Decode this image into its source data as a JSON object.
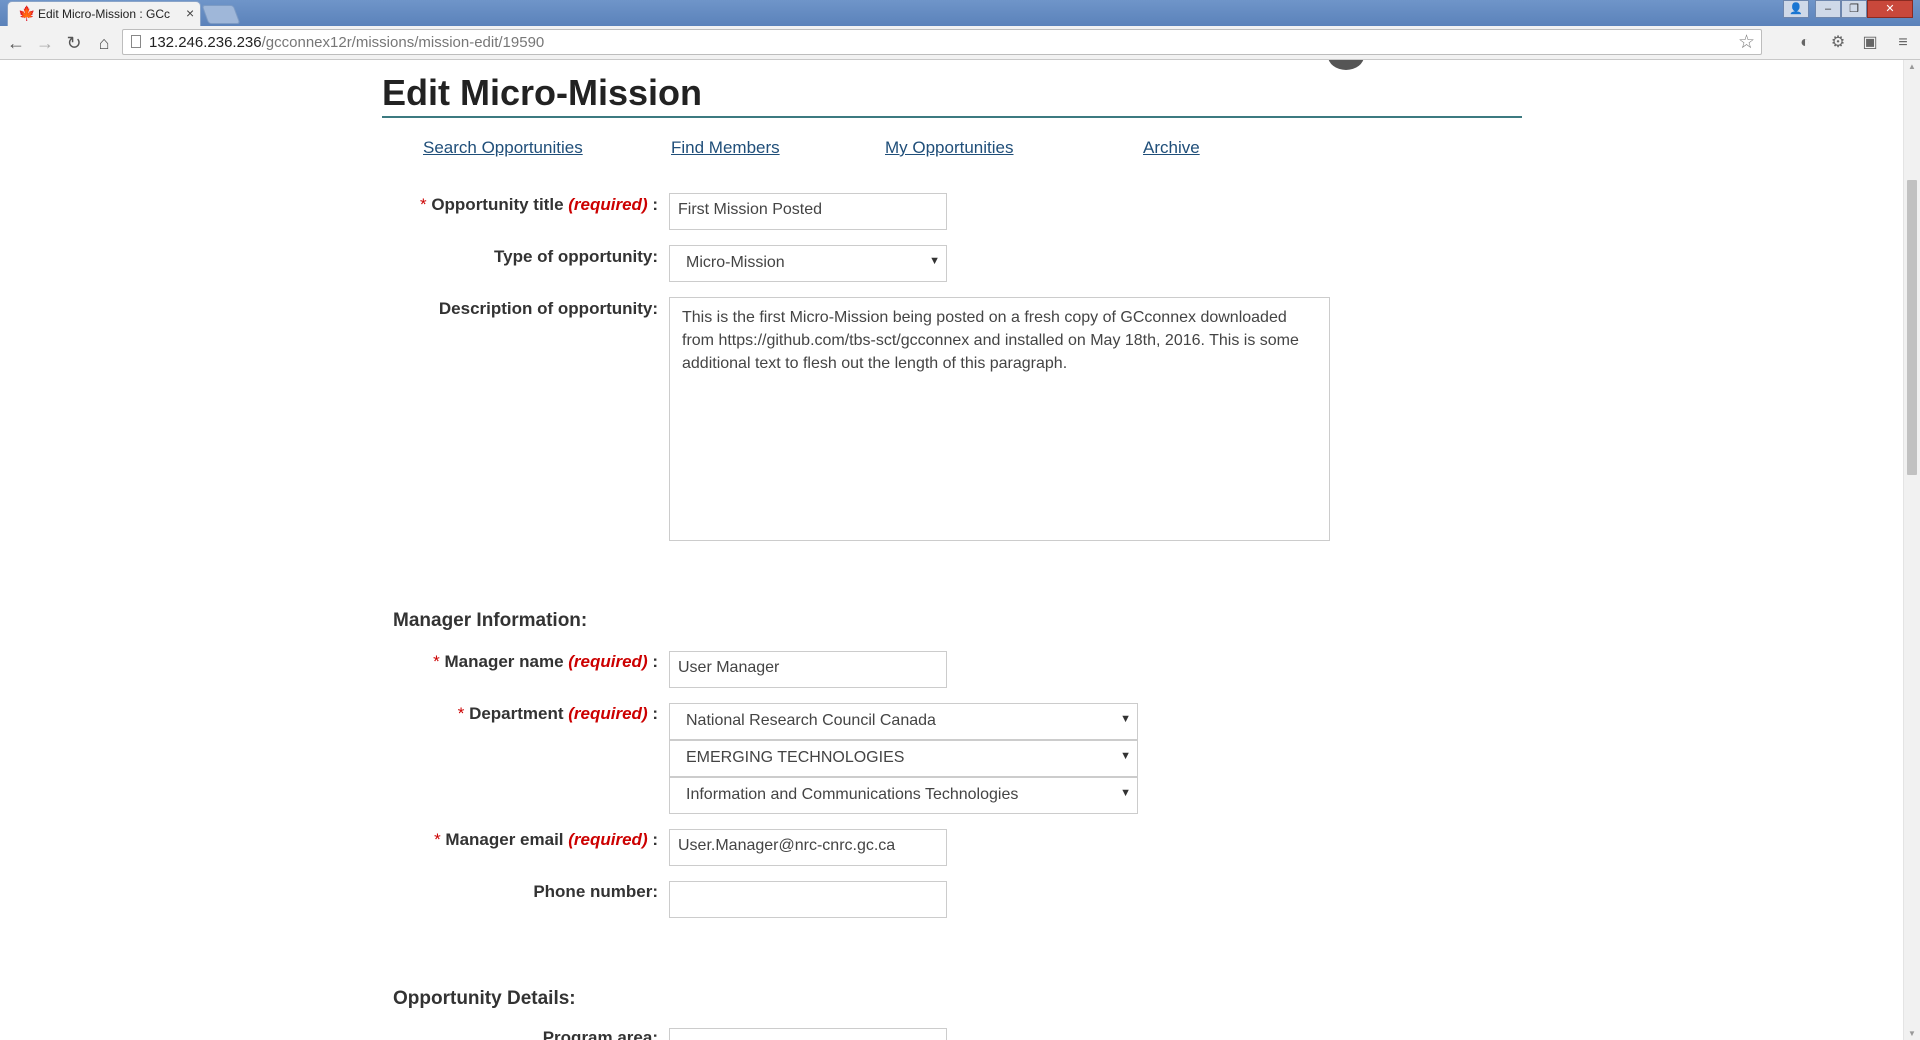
{
  "browser": {
    "tab_title": "Edit Micro-Mission : GCc",
    "url_host": "132.246.236.236",
    "url_path": "/gcconnex12r/missions/mission-edit/19590"
  },
  "page": {
    "title": "Edit Micro-Mission",
    "nav": [
      "Search Opportunities",
      "Find Members",
      "My Opportunities",
      "Archive"
    ]
  },
  "form": {
    "required_text": "(required)",
    "opportunity_title": {
      "label": "Opportunity title",
      "value": "First Mission Posted"
    },
    "type": {
      "label": "Type of opportunity:",
      "value": "Micro-Mission"
    },
    "description": {
      "label": "Description of opportunity:",
      "value": "This is the first Micro-Mission being posted on a fresh copy of GCconnex downloaded from https://github.com/tbs-sct/gcconnex and installed on May 18th, 2016. This is some additional text to flesh out the length of this paragraph."
    },
    "manager_section": "Manager Information:",
    "manager_name": {
      "label": "Manager name",
      "value": "User Manager"
    },
    "department": {
      "label": "Department",
      "values": [
        "National Research Council Canada",
        "EMERGING TECHNOLOGIES",
        "Information and Communications Technologies"
      ]
    },
    "manager_email": {
      "label": "Manager email",
      "value": "User.Manager@nrc-cnrc.gc.ca"
    },
    "phone": {
      "label": "Phone number:",
      "value": ""
    },
    "details_section": "Opportunity Details:",
    "program_area": {
      "label": "Program area:"
    }
  }
}
